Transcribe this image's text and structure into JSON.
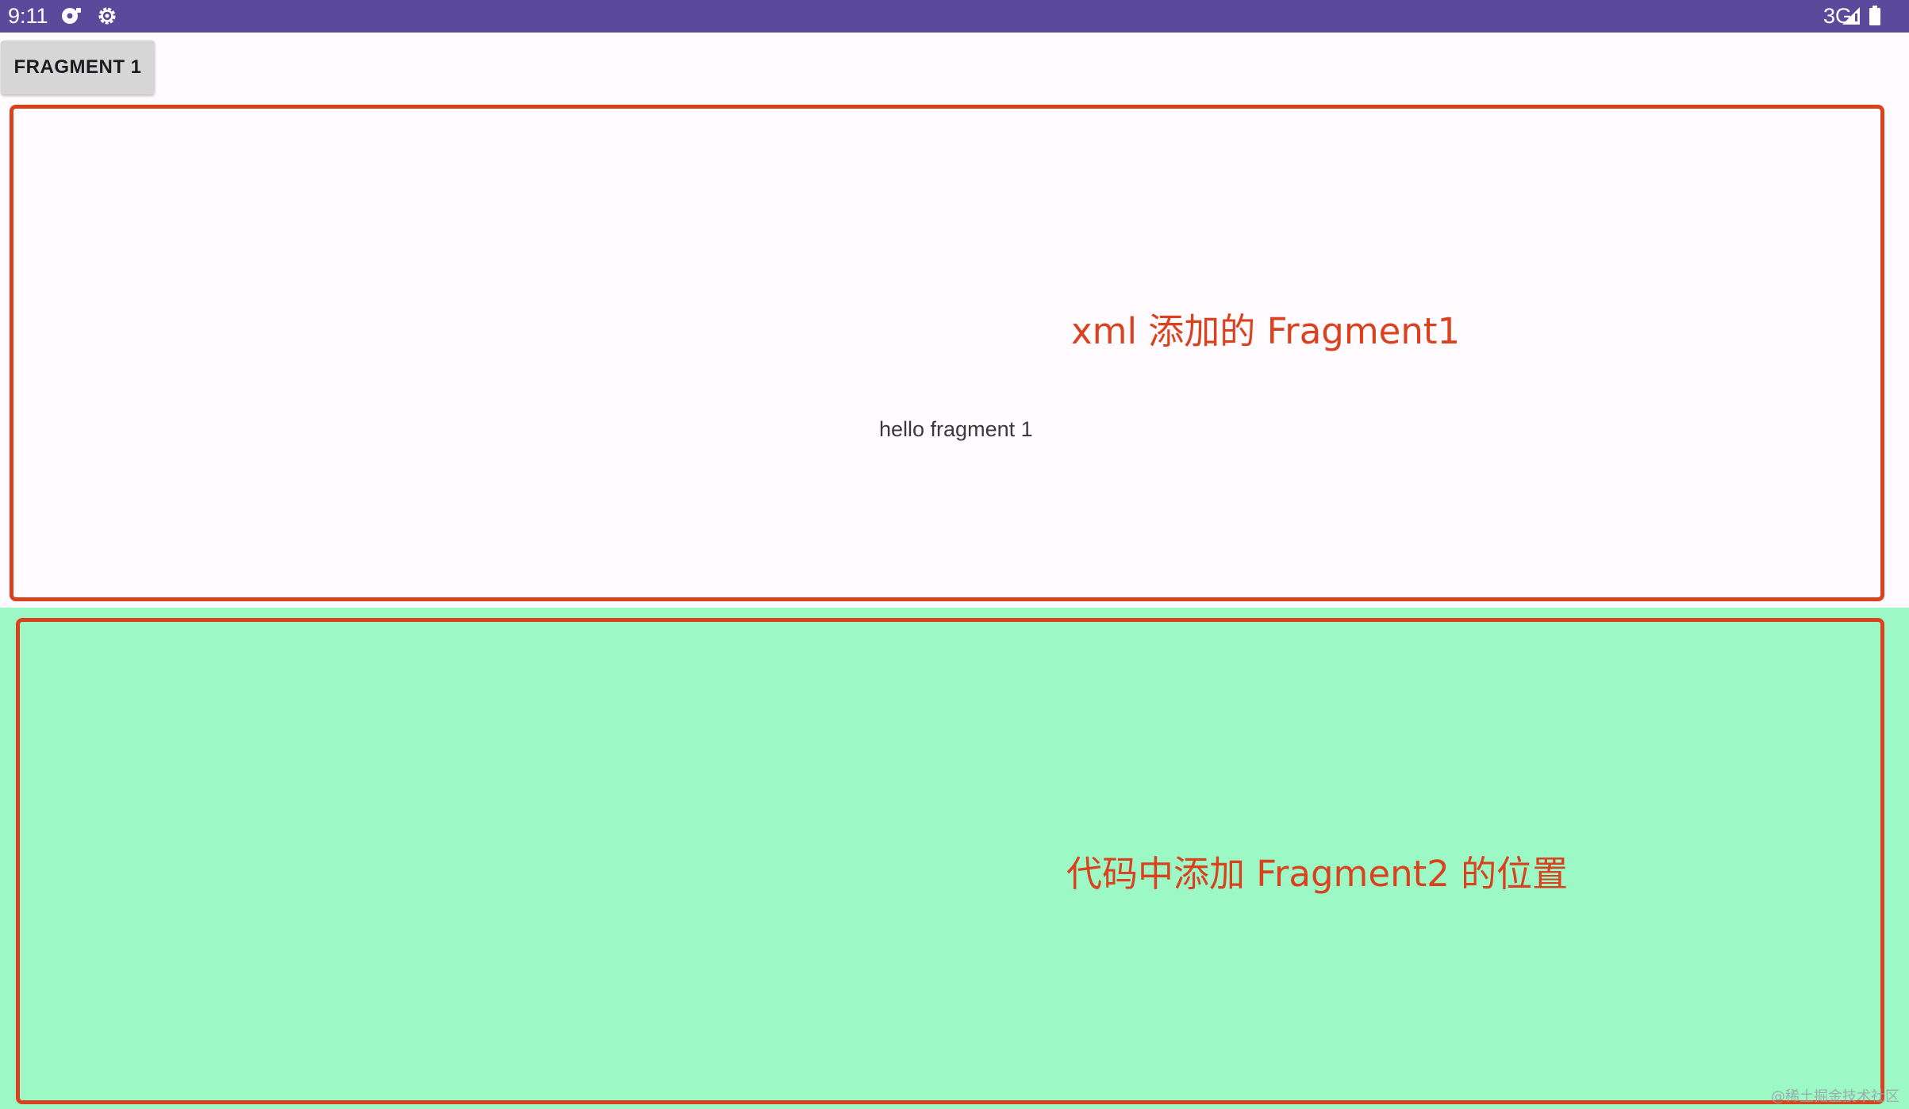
{
  "status_bar": {
    "time": "9:11",
    "network": "3G",
    "icons": [
      "sync-icon",
      "settings-gear-icon",
      "signal-icon",
      "battery-icon"
    ],
    "background_color": "#5b4a9c"
  },
  "toolbar": {
    "fragment1_button_label": "FRAGMENT 1"
  },
  "fragment1": {
    "text": "hello fragment 1"
  },
  "container2": {
    "background_color": "#9cf9c6"
  },
  "annotations": {
    "label1": "xml 添加的 Fragment1",
    "label2": "代码中添加 Fragment2 的位置",
    "color": "#d9411f"
  },
  "watermark": {
    "text": "@稀土掘金技术社区"
  }
}
